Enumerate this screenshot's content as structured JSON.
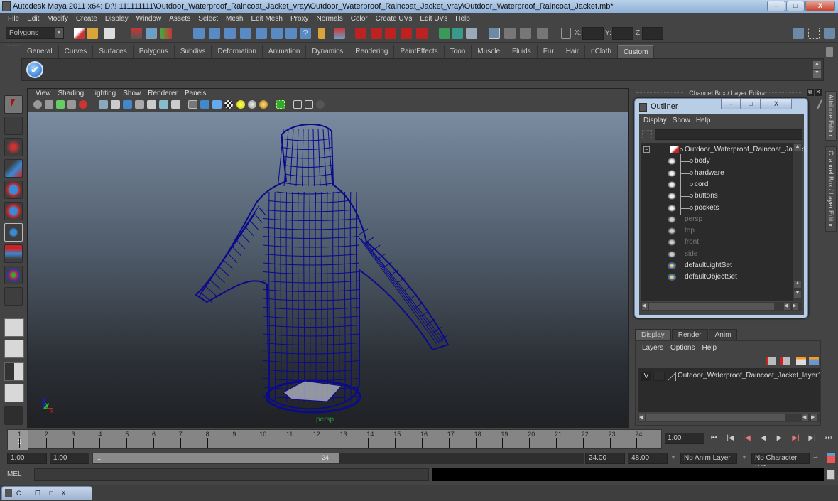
{
  "window": {
    "title": "Autodesk Maya 2011 x64: D:\\! 111111111\\Outdoor_Waterproof_Raincoat_Jacket_vray\\Outdoor_Waterproof_Raincoat_Jacket_vray\\Outdoor_Waterproof_Raincoat_Jacket.mb*",
    "minimize": "–",
    "restore": "□",
    "close": "X"
  },
  "menubar": [
    "File",
    "Edit",
    "Modify",
    "Create",
    "Display",
    "Window",
    "Assets",
    "Select",
    "Mesh",
    "Edit Mesh",
    "Proxy",
    "Normals",
    "Color",
    "Create UVs",
    "Edit UVs",
    "Help"
  ],
  "statusline": {
    "mode": "Polygons",
    "x_label": "X:",
    "y_label": "Y:",
    "z_label": "Z:",
    "x_value": "",
    "y_value": "",
    "z_value": ""
  },
  "shelf": {
    "tabs": [
      "General",
      "Curves",
      "Surfaces",
      "Polygons",
      "Subdivs",
      "Deformation",
      "Animation",
      "Dynamics",
      "Rendering",
      "PaintEffects",
      "Toon",
      "Muscle",
      "Fluids",
      "Fur",
      "Hair",
      "nCloth",
      "Custom"
    ],
    "active_tab": "Custom",
    "check_glyph": "✔"
  },
  "viewport": {
    "menu": [
      "View",
      "Shading",
      "Lighting",
      "Show",
      "Renderer",
      "Panels"
    ],
    "camera": "persp",
    "wire_color": "#0a0a8c",
    "axis": {
      "y": "y",
      "x": "x",
      "z": "z"
    }
  },
  "channelbox_header": "Channel Box / Layer Editor",
  "outliner": {
    "title": "Outliner",
    "menu": [
      "Display",
      "Show",
      "Help"
    ],
    "search": "",
    "items": [
      {
        "label": "Outdoor_Waterproof_Raincoat_Jacket",
        "type": "group",
        "dim": false
      },
      {
        "label": "body",
        "type": "mesh",
        "dim": false
      },
      {
        "label": "hardware",
        "type": "mesh",
        "dim": false
      },
      {
        "label": "cord",
        "type": "mesh",
        "dim": false
      },
      {
        "label": "buttons",
        "type": "mesh",
        "dim": false
      },
      {
        "label": "pockets",
        "type": "mesh",
        "dim": false
      },
      {
        "label": "persp",
        "type": "camera",
        "dim": true
      },
      {
        "label": "top",
        "type": "camera",
        "dim": true
      },
      {
        "label": "front",
        "type": "camera",
        "dim": true
      },
      {
        "label": "side",
        "type": "camera",
        "dim": true
      },
      {
        "label": "defaultLightSet",
        "type": "set",
        "dim": false
      },
      {
        "label": "defaultObjectSet",
        "type": "set",
        "dim": false
      }
    ]
  },
  "layer_editor": {
    "tabs": [
      "Display",
      "Render",
      "Anim"
    ],
    "active_tab": "Display",
    "menu": [
      "Layers",
      "Options",
      "Help"
    ],
    "layers": [
      {
        "visible": "V",
        "name": "Outdoor_Waterproof_Raincoat_Jacket_layer1"
      }
    ]
  },
  "side_tabs": [
    "Attribute Editor",
    "Channel Box / Layer Editor"
  ],
  "timeline": {
    "start": 1,
    "end": 24,
    "current": 1,
    "ticks": [
      "1",
      "2",
      "3",
      "4",
      "5",
      "6",
      "7",
      "8",
      "9",
      "10",
      "11",
      "12",
      "13",
      "14",
      "15",
      "16",
      "17",
      "18",
      "19",
      "20",
      "21",
      "22",
      "23",
      "24"
    ],
    "current_label": "1",
    "current_time_field": "1.00",
    "playback_buttons": [
      "⏮",
      "|◀",
      "|◀",
      "◀",
      "▶",
      "▶|",
      "▶|",
      "⏭"
    ]
  },
  "range": {
    "start_field": "1.00",
    "playback_start": "1.00",
    "slider_start": "1",
    "slider_end": "24",
    "playback_end": "24.00",
    "end_field": "48.00",
    "anim_layer": "No Anim Layer",
    "character_set": "No Character Set"
  },
  "cmdline": {
    "label": "MEL",
    "input": "",
    "output": ""
  },
  "taskbar": {
    "min_window_label": "C...",
    "btn1": "❐",
    "btn2": "□",
    "btn3": "X"
  }
}
